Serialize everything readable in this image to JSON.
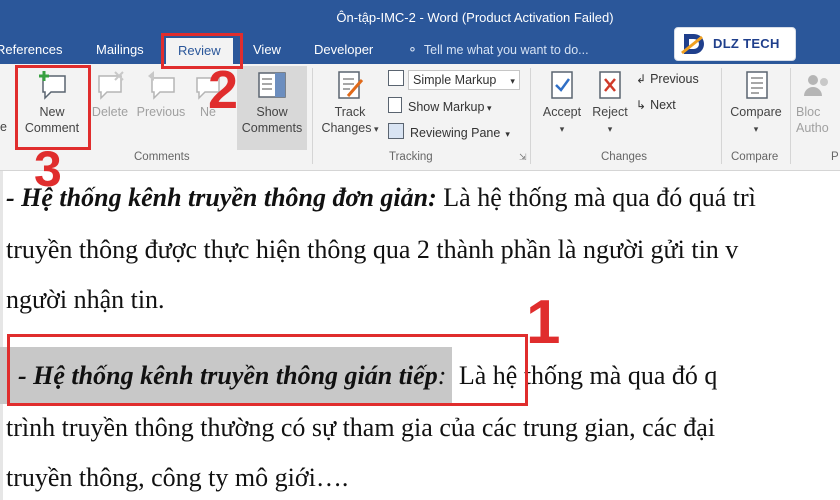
{
  "window": {
    "title": "Ôn-tập-IMC-2 - Word (Product Activation Failed)"
  },
  "tabs": [
    "References",
    "Mailings",
    "Review",
    "View",
    "Developer"
  ],
  "active_tab": "Review",
  "tell_me": {
    "placeholder": "Tell me what you want to do..."
  },
  "logo": {
    "text": "DLZ TECH"
  },
  "ribbon": {
    "comments": {
      "new_comment": [
        "New",
        "Comment"
      ],
      "delete": "Delete",
      "previous": "Previous",
      "next": "Ne",
      "show_comments": [
        "Show",
        "Comments"
      ],
      "label": "Comments"
    },
    "tracking": {
      "track_changes": [
        "Track",
        "Changes"
      ],
      "markup_dropdown": "Simple Markup",
      "show_markup": "Show Markup",
      "reviewing_pane": "Reviewing Pane",
      "label": "Tracking"
    },
    "changes": {
      "accept": "Accept",
      "reject": "Reject",
      "previous": "Previous",
      "next": "Next",
      "label": "Changes"
    },
    "compare": {
      "button": "Compare",
      "label": "Compare"
    },
    "block": {
      "line1": "Bloc",
      "line2": "Autho",
      "label": "P"
    }
  },
  "annotations": {
    "step1": "1",
    "step2": "2",
    "step3": "3"
  },
  "document": {
    "p1_bold": "- Hệ thống kênh truyền thông đơn giản:",
    "p1_rest": " Là hệ thống mà qua đó quá trì",
    "p1_line2": "truyền thông được thực hiện thông qua 2 thành phần là người gửi tin v",
    "p1_line3": "người nhận tin.",
    "p2_dash": "- ",
    "p2_bold": "Hệ thống kênh truyền thông gián tiếp",
    "p2_colon": ":",
    "p2_rest": " Là hệ thống mà qua đó q",
    "p2_line2": "trình truyền thông thường có sự tham gia của các trung gian, các đại",
    "p2_line3": "truyền thông, công ty mô giới…."
  }
}
